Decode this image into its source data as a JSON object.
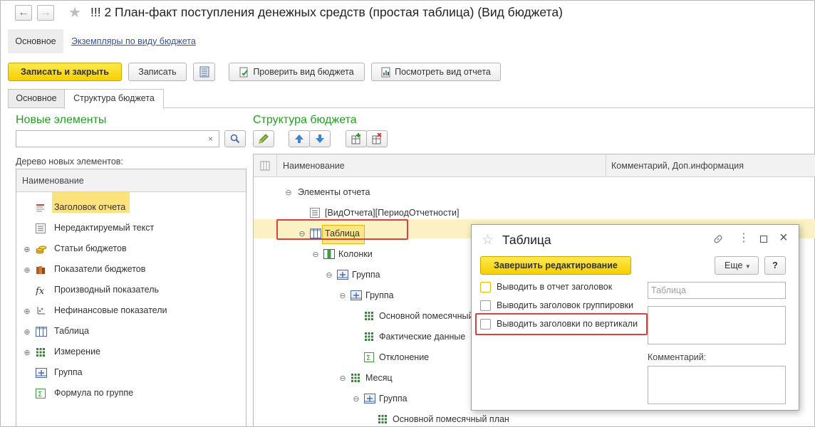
{
  "window": {
    "title": "!!! 2 План-факт поступления денежных средств (простая таблица) (Вид бюджета)"
  },
  "top_tabs": {
    "main": "Основное",
    "link": "Экземпляры по виду бюджета"
  },
  "toolbar": {
    "save_close": "Записать и закрыть",
    "save": "Записать",
    "check": "Проверить вид бюджета",
    "view_report": "Посмотреть вид отчета"
  },
  "content_tabs": {
    "main": "Основное",
    "structure": "Структура бюджета"
  },
  "left": {
    "title": "Новые элементы",
    "tree_label": "Дерево новых элементов:",
    "column": "Наименование",
    "items": [
      {
        "label": "Заголовок отчета",
        "icon": "report-header-icon",
        "expand": ""
      },
      {
        "label": "Нередактируемый текст",
        "icon": "text-icon",
        "expand": ""
      },
      {
        "label": "Статьи бюджетов",
        "icon": "coins-icon",
        "expand": "⊕"
      },
      {
        "label": "Показатели бюджетов",
        "icon": "books-icon",
        "expand": "⊕"
      },
      {
        "label": "Производный показатель",
        "icon": "fx-icon",
        "expand": ""
      },
      {
        "label": "Нефинансовые показатели",
        "icon": "axis-icon",
        "expand": "⊕"
      },
      {
        "label": "Таблица",
        "icon": "table-icon",
        "expand": "⊕"
      },
      {
        "label": "Измерение",
        "icon": "grid-icon",
        "expand": "⊕"
      },
      {
        "label": "Группа",
        "icon": "group-icon",
        "expand": ""
      },
      {
        "label": "Формула по группе",
        "icon": "sigma-icon",
        "expand": ""
      }
    ]
  },
  "right": {
    "title": "Структура бюджета",
    "col_name": "Наименование",
    "col_comment": "Комментарий, Доп.информация",
    "rows": [
      {
        "label": "Элементы отчета",
        "level": 0,
        "icon": "",
        "expand": "⊖"
      },
      {
        "label": "[ВидОтчета][ПериодОтчетности]",
        "level": 1,
        "icon": "text-icon",
        "expand": ""
      },
      {
        "label": "Таблица",
        "level": 1,
        "icon": "table-icon",
        "expand": "⊖"
      },
      {
        "label": "Колонки",
        "level": 2,
        "icon": "columns-icon",
        "expand": "⊖"
      },
      {
        "label": "Группа",
        "level": 3,
        "icon": "group-icon",
        "expand": "⊖"
      },
      {
        "label": "Группа",
        "level": 4,
        "icon": "group-icon",
        "expand": "⊖"
      },
      {
        "label": "Основной помесячный план",
        "level": 5,
        "icon": "grid-icon",
        "expand": ""
      },
      {
        "label": "Фактические данные",
        "level": 5,
        "icon": "grid-icon",
        "expand": ""
      },
      {
        "label": "Отклонение",
        "level": 5,
        "icon": "sigma-icon",
        "expand": ""
      },
      {
        "label": "Месяц",
        "level": 4,
        "icon": "grid-icon",
        "expand": "⊖"
      },
      {
        "label": "Группа",
        "level": 5,
        "icon": "group-icon",
        "expand": "⊖"
      },
      {
        "label": "Основной помесячный план",
        "level": 6,
        "icon": "grid-icon",
        "expand": ""
      }
    ]
  },
  "dialog": {
    "title": "Таблица",
    "finish": "Завершить редактирование",
    "more": "Еще",
    "help": "?",
    "cb1": "Выводить в отчет заголовок",
    "cb2": "Выводить заголовок группировки",
    "cb3": "Выводить заголовки по вертикали",
    "title_placeholder": "Таблица",
    "comment_label": "Комментарий:"
  },
  "colors": {
    "accent_green": "#22a022",
    "button_yellow": "#f5cf00",
    "highlight": "#d84141"
  }
}
